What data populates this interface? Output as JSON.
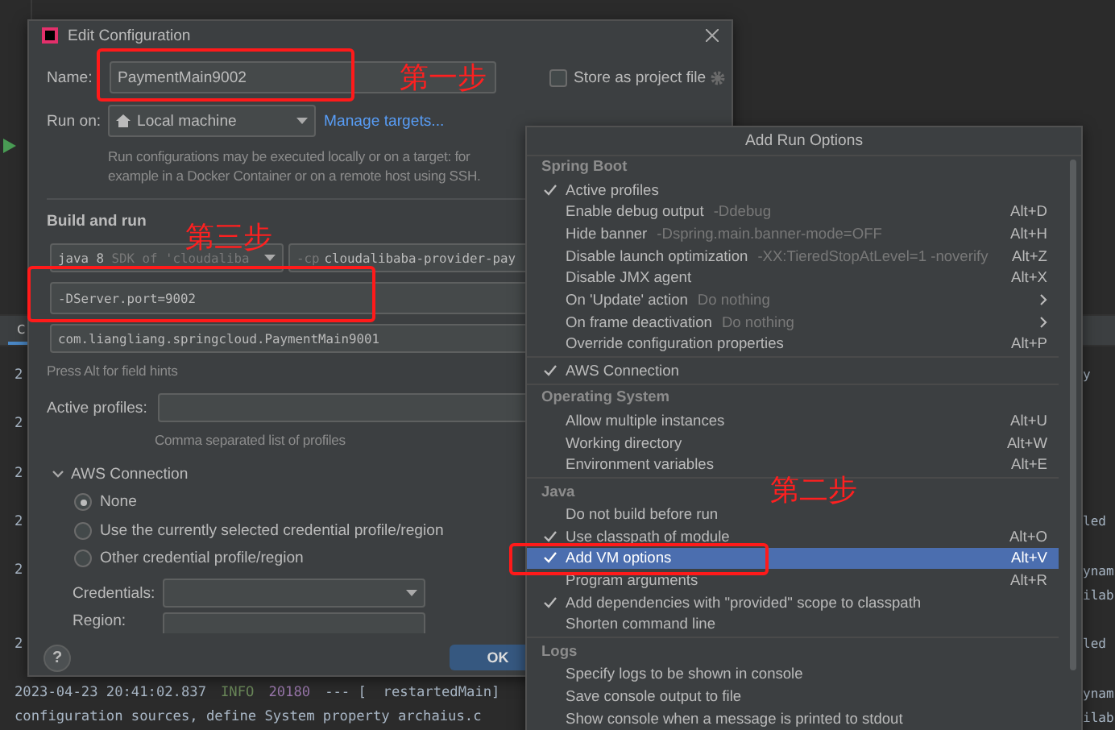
{
  "tool_tab": {
    "label": "c",
    "selected": true
  },
  "console_lines": [
    {
      "kind": "text",
      "left": [
        {
          "kind": "plain",
          "text": "2"
        }
      ],
      "right": "y"
    },
    {
      "kind": "blank"
    },
    {
      "kind": "text",
      "left": [
        {
          "kind": "plain",
          "text": "2"
        }
      ]
    },
    {
      "kind": "blank"
    },
    {
      "kind": "text",
      "left": [
        {
          "kind": "plain",
          "text": "2"
        }
      ]
    },
    {
      "kind": "blank"
    },
    {
      "kind": "text",
      "left": [
        {
          "kind": "plain",
          "text": "2"
        }
      ],
      "right": "led"
    },
    {
      "kind": "blank"
    },
    {
      "kind": "text",
      "left": [
        {
          "kind": "plain",
          "text": "2"
        }
      ],
      "right": "ynam"
    },
    {
      "kind": "text",
      "right": "ilab"
    },
    {
      "kind": "blank"
    },
    {
      "kind": "text",
      "left": [
        {
          "kind": "plain",
          "text": "2"
        }
      ],
      "right": "led"
    },
    {
      "kind": "blank"
    },
    {
      "kind": "text",
      "left": [
        {
          "kind": "plain",
          "text": "2023-04-23 20:41:02.837"
        },
        {
          "kind": "level",
          "text": "INFO"
        },
        {
          "kind": "pid",
          "text": "20180"
        },
        {
          "kind": "plain",
          "text": "--- [  restartedMain]"
        }
      ],
      "right": "ynam"
    },
    {
      "kind": "text",
      "left": [
        {
          "kind": "plain",
          "text": "configuration sources, define System property archaius.c"
        }
      ],
      "right": "ilab"
    }
  ],
  "dialog": {
    "title": "Edit Configuration",
    "name_label": "Name:",
    "name_value": "PaymentMain9002",
    "store_checkbox": {
      "label": "Store as project file",
      "checked": false
    },
    "run_on_label": "Run on:",
    "run_on_value": "Local machine",
    "manage_link": "Manage targets...",
    "run_on_hint": [
      "Run configurations may be executed locally or on a target: for",
      "example in a Docker Container or on a remote host using SSH."
    ],
    "section_title": "Build and run",
    "jre_version": "java 8",
    "jre_detail": "SDK of 'cloudaliba",
    "classpath_flag": "-cp",
    "classpath_module": "cloudalibaba-provider-pay",
    "vm_options": "-DServer.port=9002",
    "main_class": "com.liangliang.springcloud.PaymentMain9001",
    "field_hint": "Press Alt for field hints",
    "active_profiles_label": "Active profiles:",
    "active_profiles_hint": "Comma separated list of profiles",
    "aws": {
      "title": "AWS Connection",
      "expanded": true,
      "options": [
        {
          "label": "None",
          "selected": true
        },
        {
          "label": "Use the currently selected credential profile/region",
          "selected": false
        },
        {
          "label": "Other credential profile/region",
          "selected": false
        }
      ],
      "credentials_label": "Credentials:",
      "region_label": "Region:"
    },
    "help": "?",
    "ok": "OK"
  },
  "popup": {
    "title": "Add Run Options",
    "groups": [
      {
        "header": "Spring Boot",
        "items": [
          {
            "label": "Active profiles",
            "checked": true,
            "selected": false,
            "submenu": false
          },
          {
            "label": "Enable debug output",
            "hint": "-Ddebug",
            "shortcut": "Alt+D",
            "checked": false,
            "selected": false,
            "submenu": false
          },
          {
            "label": "Hide banner",
            "hint": "-Dspring.main.banner-mode=OFF",
            "shortcut": "Alt+H",
            "checked": false,
            "selected": false,
            "submenu": false
          },
          {
            "label": "Disable launch optimization",
            "hint": "-XX:TieredStopAtLevel=1 -noverify",
            "shortcut": "Alt+Z",
            "checked": false,
            "selected": false,
            "submenu": false
          },
          {
            "label": "Disable JMX agent",
            "shortcut": "Alt+X",
            "checked": false,
            "selected": false,
            "submenu": false
          },
          {
            "label": "On 'Update' action",
            "hint": "Do nothing",
            "checked": false,
            "selected": false,
            "submenu": true
          },
          {
            "label": "On frame deactivation",
            "hint": "Do nothing",
            "checked": false,
            "selected": false,
            "submenu": true
          },
          {
            "label": "Override configuration properties",
            "shortcut": "Alt+P",
            "checked": false,
            "selected": false,
            "submenu": false
          }
        ]
      },
      {
        "items": [
          {
            "label": "AWS Connection",
            "checked": true,
            "selected": false,
            "submenu": false
          }
        ]
      },
      {
        "header": "Operating System",
        "items": [
          {
            "label": "Allow multiple instances",
            "shortcut": "Alt+U",
            "checked": false,
            "selected": false,
            "submenu": false
          },
          {
            "label": "Working directory",
            "shortcut": "Alt+W",
            "checked": false,
            "selected": false,
            "submenu": false
          },
          {
            "label": "Environment variables",
            "shortcut": "Alt+E",
            "checked": false,
            "selected": false,
            "submenu": false
          }
        ]
      },
      {
        "header": "Java",
        "items": [
          {
            "label": "Do not build before run",
            "checked": false,
            "selected": false,
            "submenu": false
          },
          {
            "label": "Use classpath of module",
            "shortcut": "Alt+O",
            "checked": true,
            "selected": false,
            "submenu": false
          },
          {
            "label": "Add VM options",
            "shortcut": "Alt+V",
            "checked": true,
            "selected": true,
            "submenu": false
          },
          {
            "label": "Program arguments",
            "shortcut": "Alt+R",
            "checked": false,
            "selected": false,
            "submenu": false
          },
          {
            "label": "Add dependencies with \"provided\" scope to classpath",
            "checked": true,
            "selected": false,
            "submenu": false
          },
          {
            "label": "Shorten command line",
            "checked": false,
            "selected": false,
            "submenu": false
          }
        ]
      },
      {
        "header": "Logs",
        "items": [
          {
            "label": "Specify logs to be shown in console",
            "checked": false,
            "selected": false,
            "submenu": false
          },
          {
            "label": "Save console output to file",
            "checked": false,
            "selected": false,
            "submenu": false
          },
          {
            "label": "Show console when a message is printed to stdout",
            "checked": false,
            "selected": false,
            "submenu": false
          }
        ]
      }
    ]
  },
  "annotations": [
    {
      "text": "第一步"
    },
    {
      "text": "第二步"
    },
    {
      "text": "第三步"
    }
  ]
}
